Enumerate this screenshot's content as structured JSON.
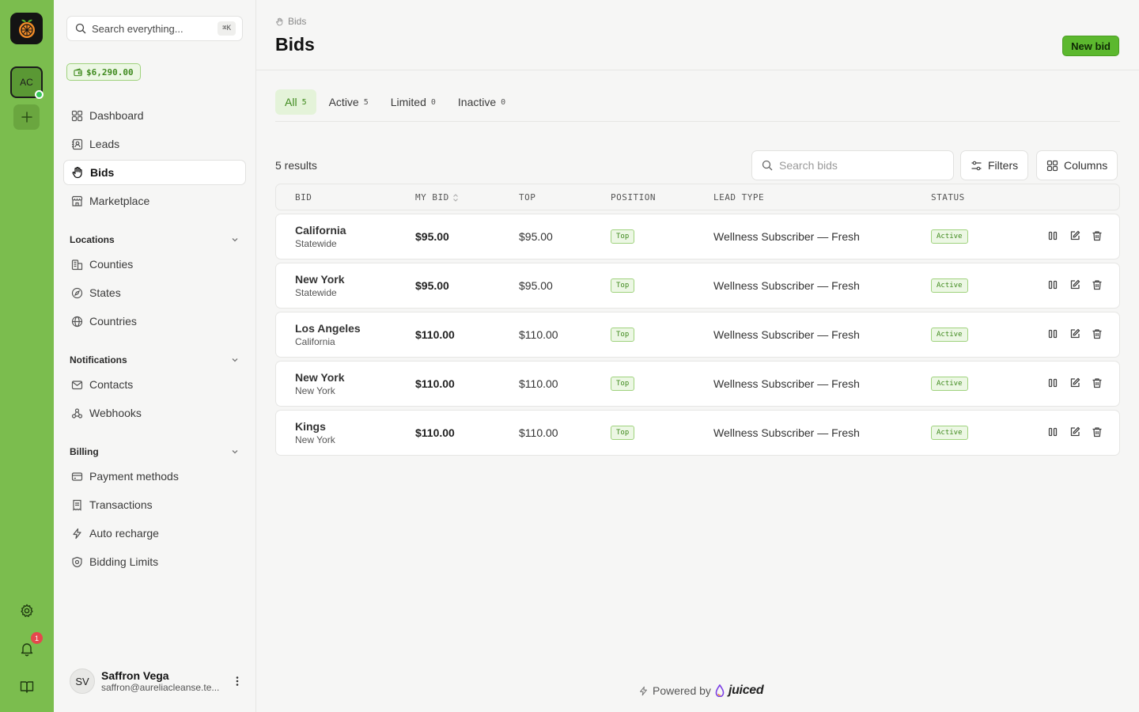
{
  "rail": {
    "org_initials": "AC",
    "notification_count": "1"
  },
  "sidebar": {
    "search": {
      "placeholder": "Search everything...",
      "shortcut": "⌘K"
    },
    "balance": "$6,290.00",
    "items": [
      {
        "label": "Dashboard",
        "icon": "grid-icon"
      },
      {
        "label": "Leads",
        "icon": "contact-book-icon"
      },
      {
        "label": "Bids",
        "icon": "hand-icon",
        "active": true
      },
      {
        "label": "Marketplace",
        "icon": "store-icon"
      }
    ],
    "locations": {
      "title": "Locations",
      "items": [
        {
          "label": "Counties",
          "icon": "buildings-icon"
        },
        {
          "label": "States",
          "icon": "compass-icon"
        },
        {
          "label": "Countries",
          "icon": "globe-icon"
        }
      ]
    },
    "notifications": {
      "title": "Notifications",
      "items": [
        {
          "label": "Contacts",
          "icon": "mail-icon"
        },
        {
          "label": "Webhooks",
          "icon": "webhook-icon"
        }
      ]
    },
    "billing": {
      "title": "Billing",
      "items": [
        {
          "label": "Payment methods",
          "icon": "credit-card-icon"
        },
        {
          "label": "Transactions",
          "icon": "receipt-icon"
        },
        {
          "label": "Auto recharge",
          "icon": "bolt-icon"
        },
        {
          "label": "Bidding Limits",
          "icon": "shield-icon"
        }
      ]
    },
    "user": {
      "initials": "SV",
      "name": "Saffron Vega",
      "email": "saffron@aureliacleanse.te..."
    }
  },
  "header": {
    "breadcrumb": "Bids",
    "title": "Bids",
    "new_button": "New bid"
  },
  "tabs": [
    {
      "label": "All",
      "count": "5",
      "active": true
    },
    {
      "label": "Active",
      "count": "5"
    },
    {
      "label": "Limited",
      "count": "0"
    },
    {
      "label": "Inactive",
      "count": "0"
    }
  ],
  "toolbar": {
    "results": "5 results",
    "search_placeholder": "Search bids",
    "filters": "Filters",
    "columns": "Columns"
  },
  "table": {
    "headers": [
      "BID",
      "MY BID",
      "TOP",
      "POSITION",
      "LEAD TYPE",
      "STATUS"
    ],
    "rows": [
      {
        "name": "California",
        "sub": "Statewide",
        "my_bid": "$95.00",
        "top": "$95.00",
        "position": "Top",
        "lead_type": "Wellness Subscriber — Fresh",
        "status": "Active"
      },
      {
        "name": "New York",
        "sub": "Statewide",
        "my_bid": "$95.00",
        "top": "$95.00",
        "position": "Top",
        "lead_type": "Wellness Subscriber — Fresh",
        "status": "Active"
      },
      {
        "name": "Los Angeles",
        "sub": "California",
        "my_bid": "$110.00",
        "top": "$110.00",
        "position": "Top",
        "lead_type": "Wellness Subscriber — Fresh",
        "status": "Active"
      },
      {
        "name": "New York",
        "sub": "New York",
        "my_bid": "$110.00",
        "top": "$110.00",
        "position": "Top",
        "lead_type": "Wellness Subscriber — Fresh",
        "status": "Active"
      },
      {
        "name": "Kings",
        "sub": "New York",
        "my_bid": "$110.00",
        "top": "$110.00",
        "position": "Top",
        "lead_type": "Wellness Subscriber — Fresh",
        "status": "Active"
      }
    ]
  },
  "footer": {
    "powered_by": "Powered by",
    "brand": "juiced"
  },
  "colors": {
    "rail": "#7bbd4e",
    "accent": "#5cb82e",
    "accent_text": "#3f8a1e",
    "badge_bg": "#ecf7e4",
    "alert": "#e5484d"
  }
}
